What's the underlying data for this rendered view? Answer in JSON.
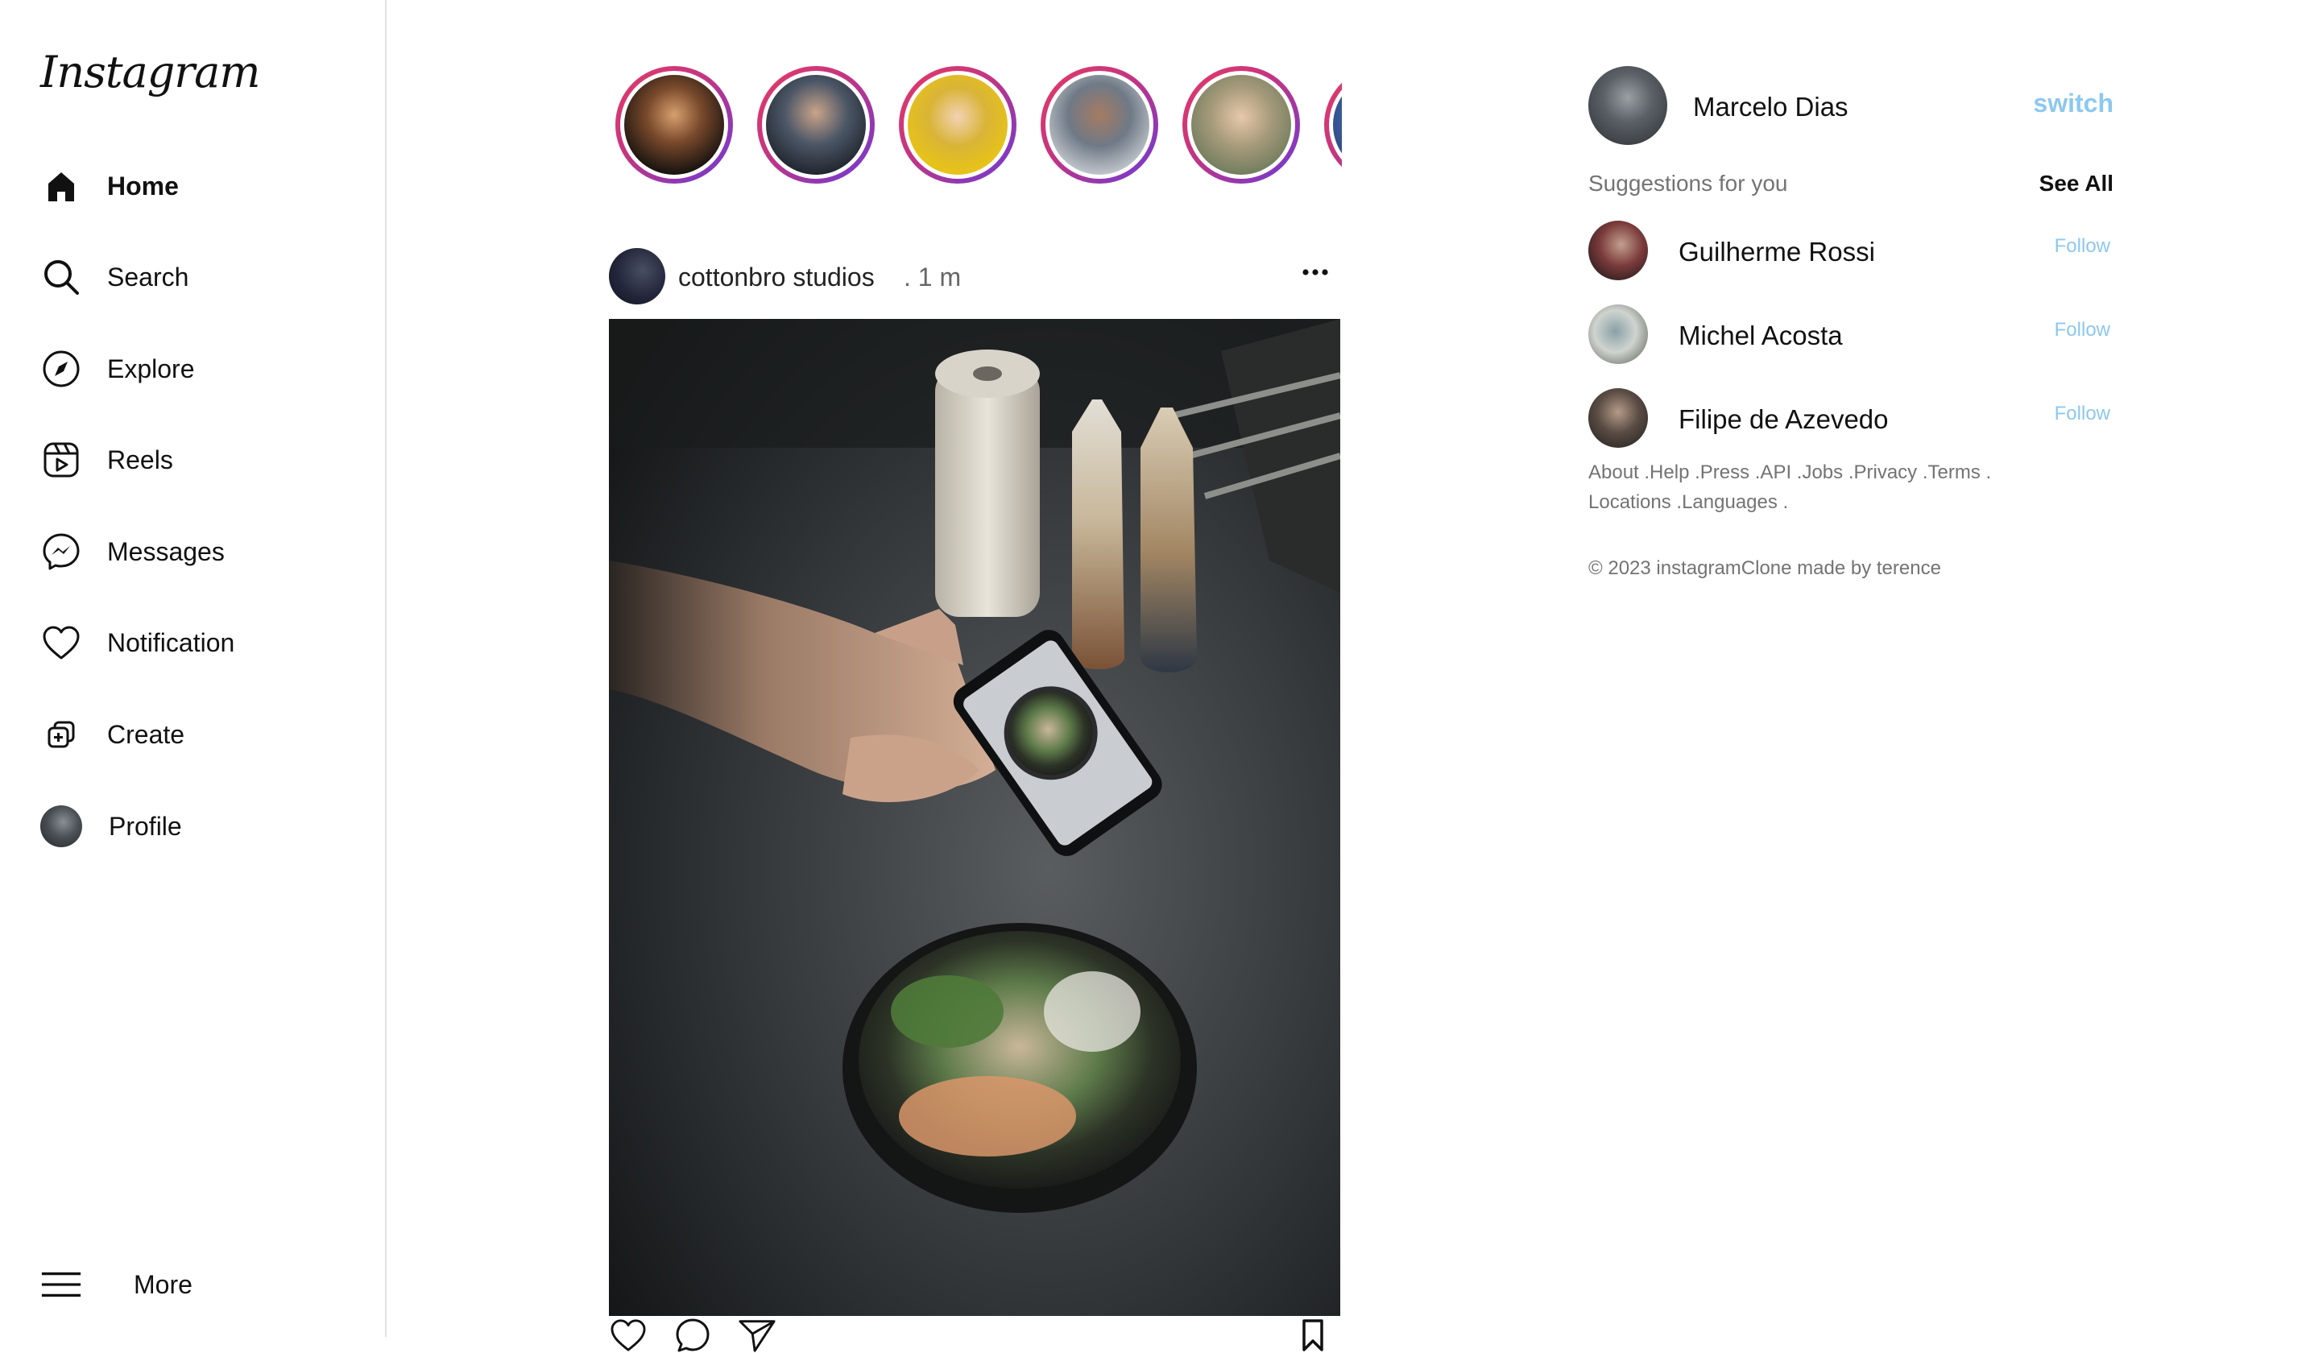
{
  "app": {
    "logo_text": "Instagram"
  },
  "sidebar": {
    "items": [
      {
        "label": "Home",
        "icon": "home-icon",
        "active": true
      },
      {
        "label": "Search",
        "icon": "search-icon"
      },
      {
        "label": "Explore",
        "icon": "compass-icon"
      },
      {
        "label": "Reels",
        "icon": "reels-icon"
      },
      {
        "label": "Messages",
        "icon": "messenger-icon"
      },
      {
        "label": "Notification",
        "icon": "heart-icon"
      },
      {
        "label": "Create",
        "icon": "create-icon"
      },
      {
        "label": "Profile",
        "icon": "avatar"
      }
    ],
    "more": {
      "label": "More",
      "icon": "menu-icon"
    }
  },
  "stories": [
    {
      "color": "#5b3a2a"
    },
    {
      "color": "#2a3340"
    },
    {
      "color": "#e6c21a"
    },
    {
      "color": "#6f7a86"
    },
    {
      "color": "#8a8a70"
    },
    {
      "color": "#3a5a9a"
    }
  ],
  "post": {
    "username": "cottonbro studios",
    "time": ". 1 m",
    "image_subject": "hand photographing a food bowl with a smartphone"
  },
  "right": {
    "me": {
      "name": "Marcelo Dias",
      "switch_label": "switch"
    },
    "suggestions_title": "Suggestions for you",
    "see_all_label": "See All",
    "suggestions": [
      {
        "name": "Guilherme Rossi",
        "follow_label": "Follow"
      },
      {
        "name": "Michel Acosta",
        "follow_label": "Follow"
      },
      {
        "name": "Filipe de Azevedo",
        "follow_label": "Follow"
      }
    ],
    "footer_links_line1": "About .Help .Press .API .Jobs .Privacy .Terms .",
    "footer_links_line2": "Locations .Languages .",
    "copyright": "© 2023 instagramClone made by terence"
  },
  "colors": {
    "accent_link": "#8cc8f0",
    "story_ring_start": "#e63a64",
    "story_ring_end": "#6a3bd8",
    "muted_text": "#737373"
  }
}
